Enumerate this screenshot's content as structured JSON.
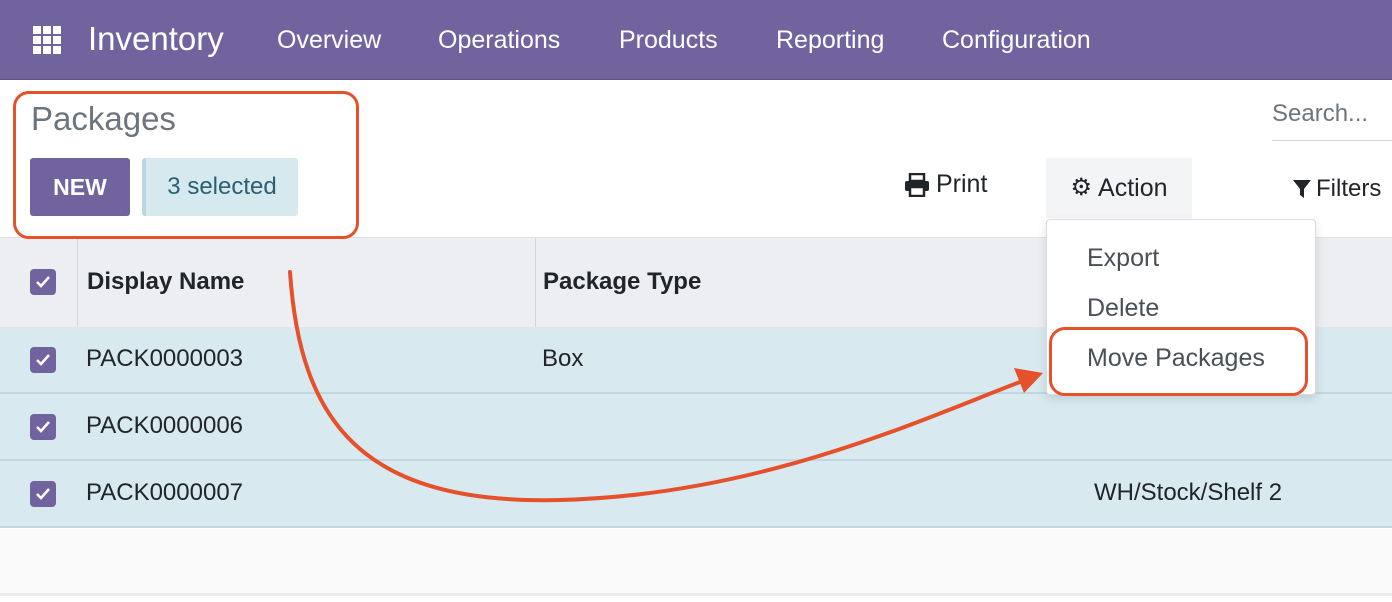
{
  "navbar": {
    "brand": "Inventory",
    "menu": [
      "Overview",
      "Operations",
      "Products",
      "Reporting",
      "Configuration"
    ]
  },
  "control_panel": {
    "title": "Packages",
    "new_label": "NEW",
    "selected_label": "3 selected",
    "print_label": "Print",
    "action_label": "Action",
    "filters_label": "Filters",
    "search_placeholder": "Search..."
  },
  "action_menu": {
    "items": [
      "Export",
      "Delete",
      "Move Packages"
    ]
  },
  "table": {
    "headers": [
      "Display Name",
      "Package Type"
    ],
    "rows": [
      {
        "name": "PACK0000003",
        "type": "Box",
        "location": "",
        "checked": true
      },
      {
        "name": "PACK0000006",
        "type": "",
        "location": "",
        "checked": true
      },
      {
        "name": "PACK0000007",
        "type": "",
        "location": "WH/Stock/Shelf 2",
        "checked": true
      }
    ]
  },
  "colors": {
    "brand": "#71639e",
    "selected_row": "#d8eaf0",
    "annotation": "#e5512b"
  }
}
